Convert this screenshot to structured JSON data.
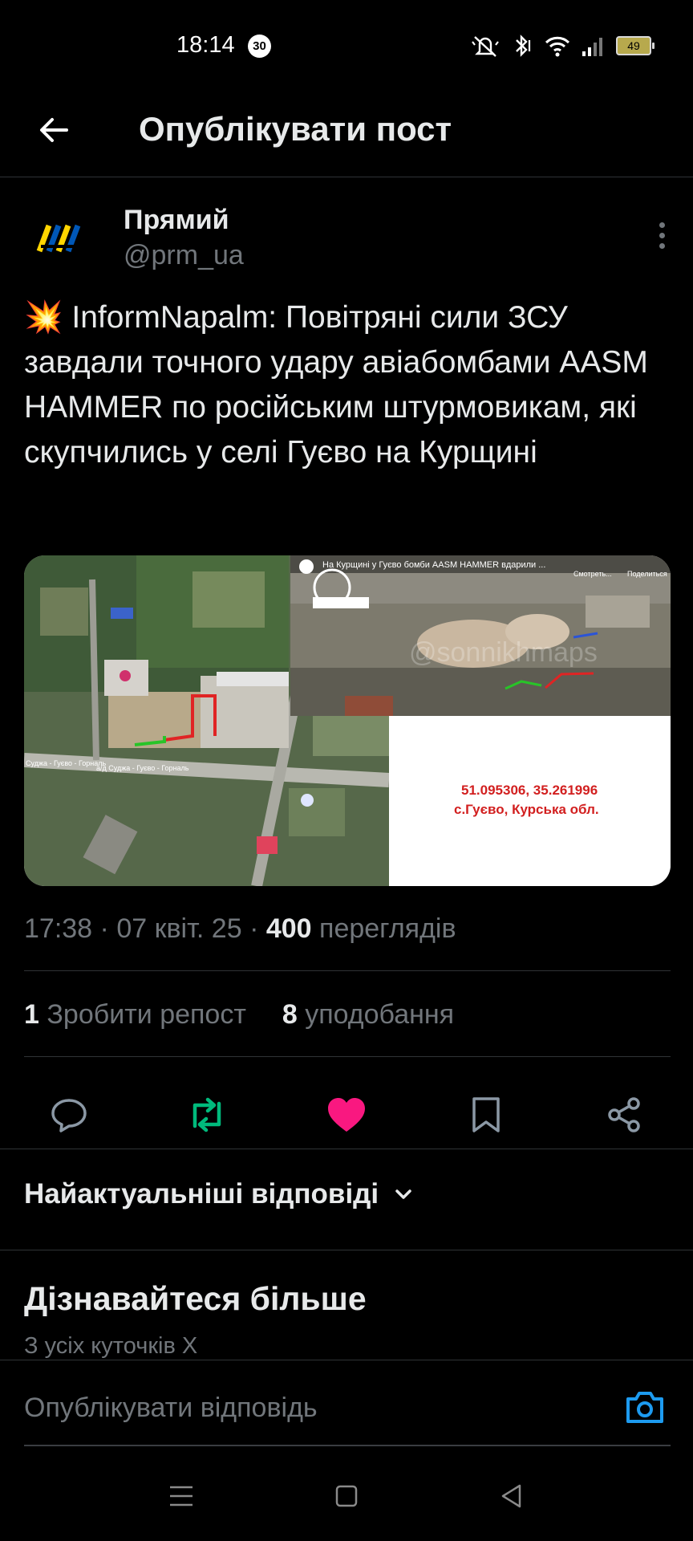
{
  "status_bar": {
    "time": "18:14",
    "notification_count": "30",
    "battery": "49",
    "icons": [
      "mute-icon",
      "bluetooth-icon",
      "wifi-icon",
      "signal-icon",
      "battery-icon"
    ]
  },
  "header": {
    "title": "Опублікувати пост",
    "back_icon": "arrow-left-icon"
  },
  "post": {
    "author_name": "Прямий",
    "author_handle": "@prm_ua",
    "text": "💥 InformNapalm: Повітряні сили ЗСУ завдали точного удару авіабомбами AASM HAMMER по російським штурмовикам, які скупчились у селі Гуєво на Курщині",
    "media": {
      "video_caption": "На Курщині у Гуєво бомби AASM HAMMER вдарили ...",
      "watch_label": "Смотреть...",
      "share_label": "Поделиться",
      "watermark": "@sonnikhmaps",
      "coordinates": "51.095306, 35.261996",
      "location": "с.Гуєво, Курська обл.",
      "road_label_1": "Суджа - Гуєво - Горналь",
      "road_label_2": "а/д Суджа - Гуєво - Горналь"
    },
    "time": "17:38",
    "date": "07 квіт. 25",
    "views_count": "400",
    "views_label": "переглядів",
    "reposts_count": "1",
    "reposts_label": "Зробити репост",
    "likes_count": "8",
    "likes_label": "уподобання"
  },
  "actions": [
    {
      "icon": "reply-icon"
    },
    {
      "icon": "repost-icon",
      "color": "#00ba7c"
    },
    {
      "icon": "like-icon",
      "color": "#f91880"
    },
    {
      "icon": "bookmark-icon"
    },
    {
      "icon": "share-icon"
    }
  ],
  "replies_sort": {
    "label": "Найактуальніші відповіді"
  },
  "learn_more": {
    "title": "Дізнавайтеся більше",
    "subtitle": "З усіх куточків X"
  },
  "reply_composer": {
    "placeholder": "Опублікувати відповідь",
    "accent": "#1d9bf0"
  },
  "nav": [
    "menu-icon",
    "home-icon",
    "back-icon"
  ]
}
